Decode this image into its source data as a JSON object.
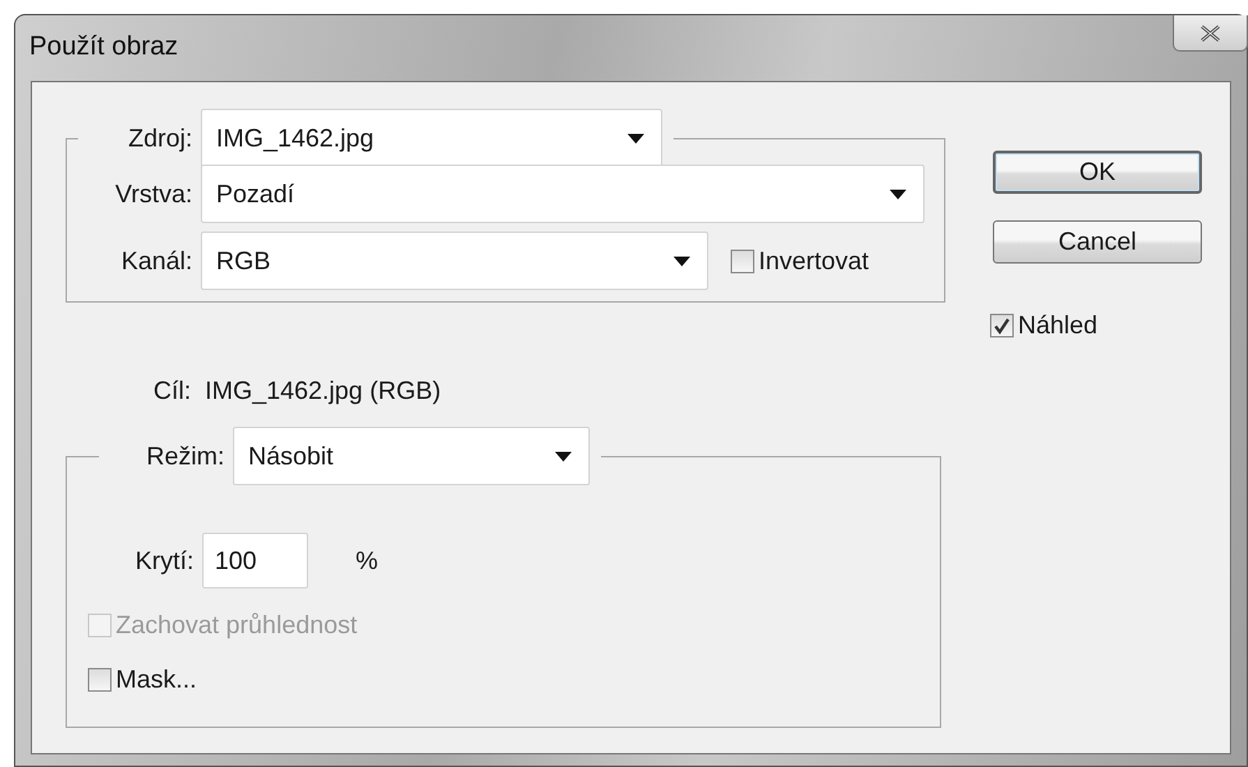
{
  "window": {
    "title": "Použít obraz"
  },
  "source": {
    "label": "Zdroj:",
    "value": "IMG_1462.jpg"
  },
  "layer": {
    "label": "Vrstva:",
    "value": "Pozadí"
  },
  "channel": {
    "label": "Kanál:",
    "value": "RGB"
  },
  "invert": {
    "label": "Invertovat",
    "checked": false,
    "disabled": false
  },
  "target": {
    "label": "Cíl:",
    "value": "IMG_1462.jpg (RGB)"
  },
  "blending": {
    "mode": {
      "label": "Režim:",
      "value": "Násobit"
    },
    "opacity": {
      "label": "Krytí:",
      "value": "100",
      "unit": "%"
    },
    "preserve_transparency": {
      "label": "Zachovat průhlednost",
      "checked": false,
      "disabled": true
    },
    "mask": {
      "label": "Mask...",
      "checked": false,
      "disabled": false
    }
  },
  "buttons": [
    {
      "label": "OK",
      "default": true
    },
    {
      "label": "Cancel",
      "default": false
    }
  ],
  "preview": {
    "label": "Náhled",
    "checked": true,
    "disabled": false
  }
}
